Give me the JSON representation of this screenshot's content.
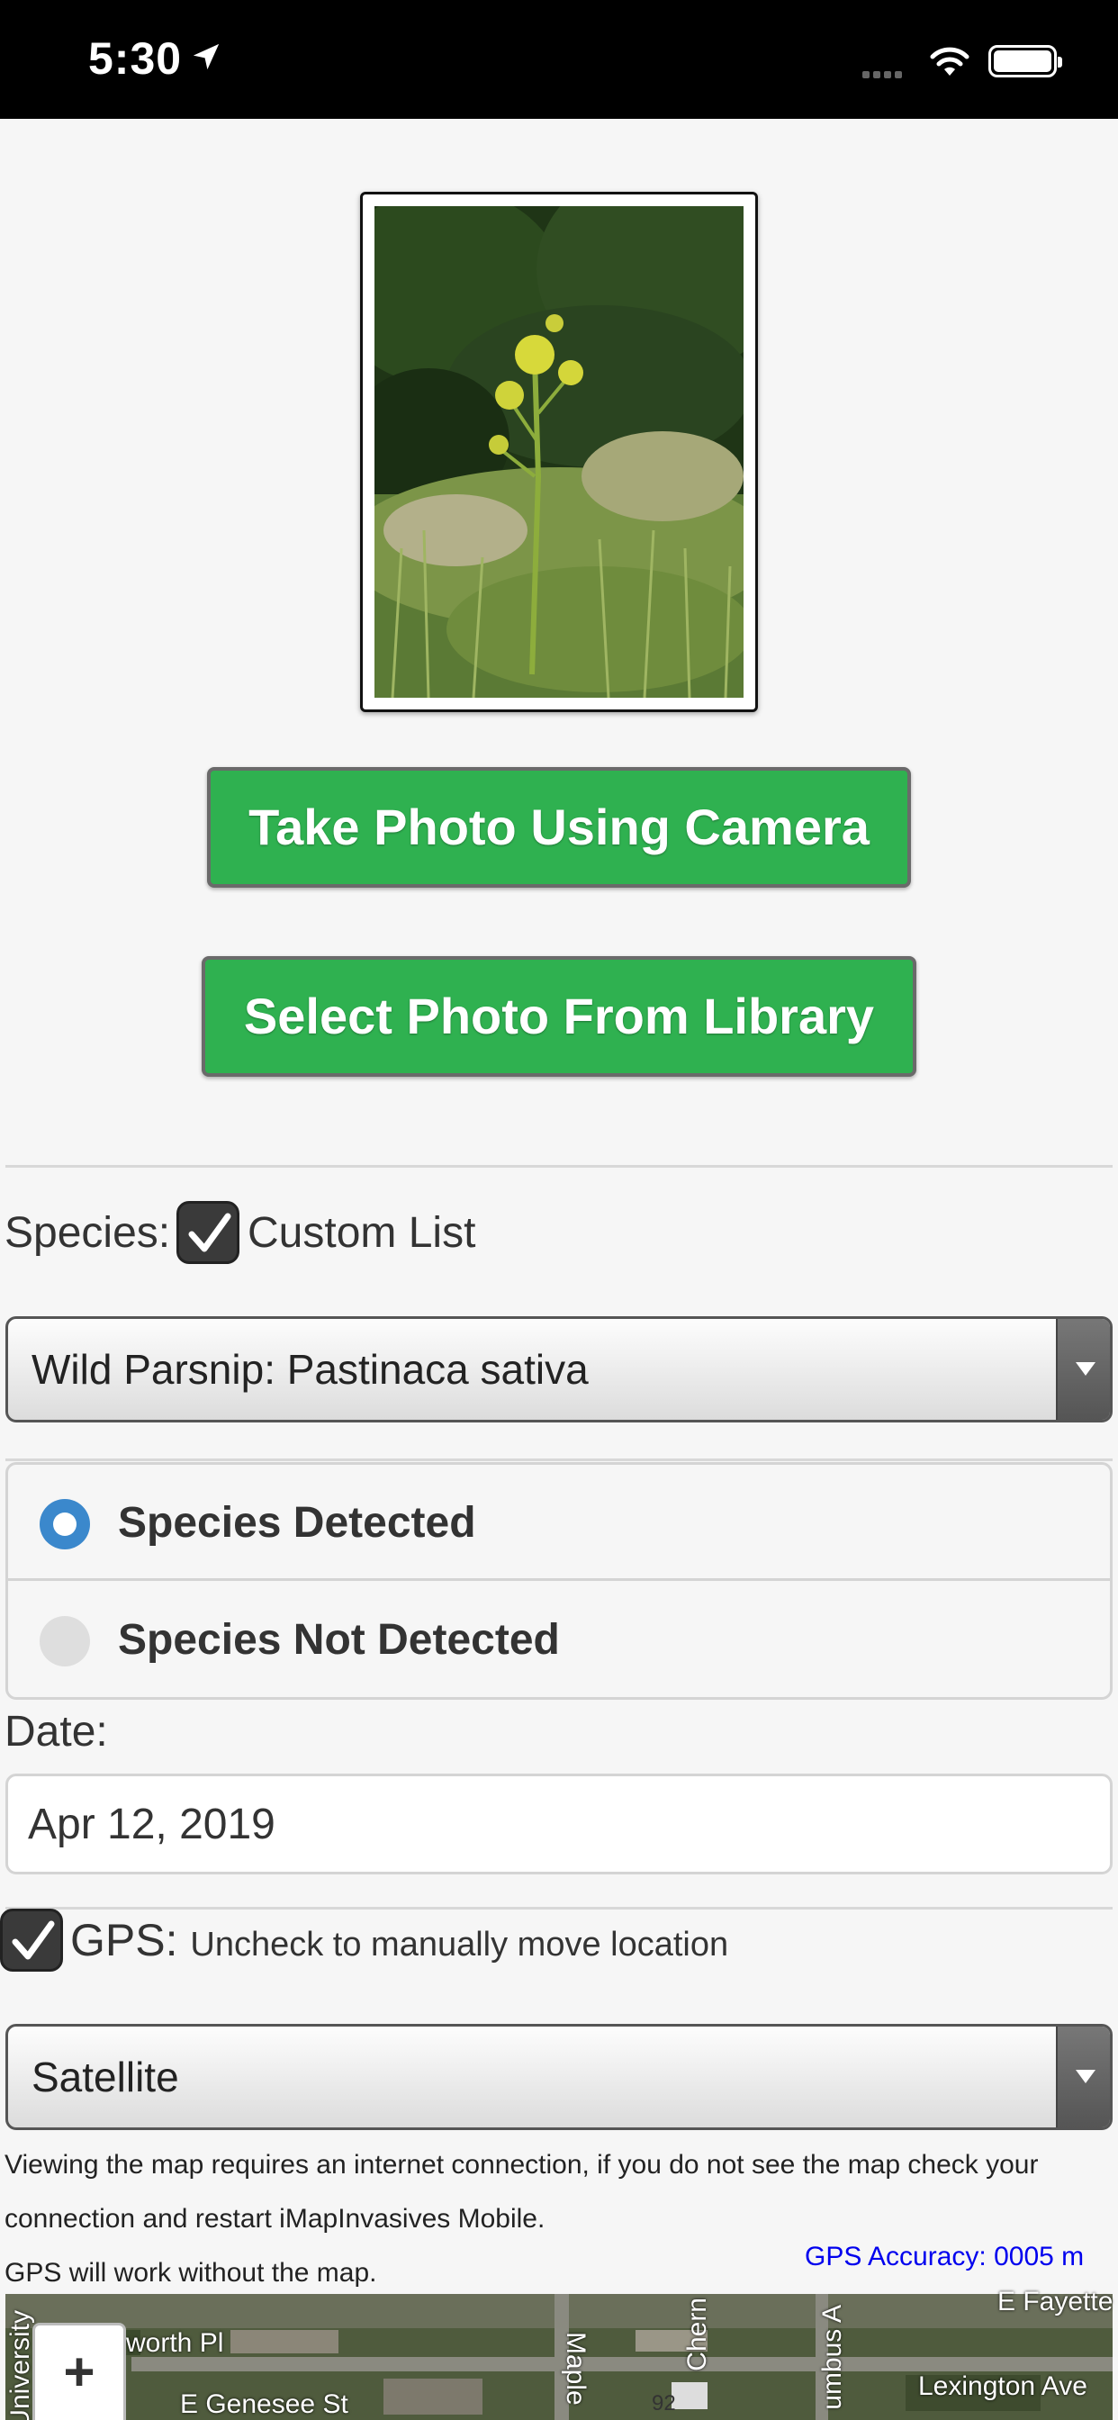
{
  "status_bar": {
    "time": "5:30"
  },
  "photo": {
    "subject": "wild parsnip plant in tall grass"
  },
  "buttons": {
    "camera": "Take Photo Using Camera",
    "library": "Select Photo From Library"
  },
  "species": {
    "label": "Species:",
    "custom_list_label": "Custom List",
    "custom_list_checked": true,
    "selected": "Wild Parsnip: Pastinaca sativa"
  },
  "detection": {
    "options": [
      "Species Detected",
      "Species Not Detected"
    ],
    "selected": "Species Detected"
  },
  "date": {
    "label": "Date:",
    "value": "Apr 12, 2019"
  },
  "gps": {
    "label": "GPS:",
    "hint": "Uncheck to manually move location",
    "checked": true,
    "accuracy": "GPS Accuracy: 0005 m"
  },
  "map_type": {
    "selected": "Satellite"
  },
  "info": {
    "line1": "Viewing the map requires an internet connection, if you do not see the map check your",
    "line2": "connection and restart iMapInvasives Mobile.",
    "line3": "GPS will work without the map."
  },
  "map": {
    "zoom_in": "+",
    "labels": [
      "University",
      "worth Pl",
      "E Genesee St",
      "Maple",
      "Chern",
      "umbus A",
      "E Fayette",
      "Lexington Ave",
      "92"
    ]
  },
  "colors": {
    "button_green": "#2fb150",
    "radio_blue": "#3b88cc",
    "link_blue": "#0000ee"
  }
}
